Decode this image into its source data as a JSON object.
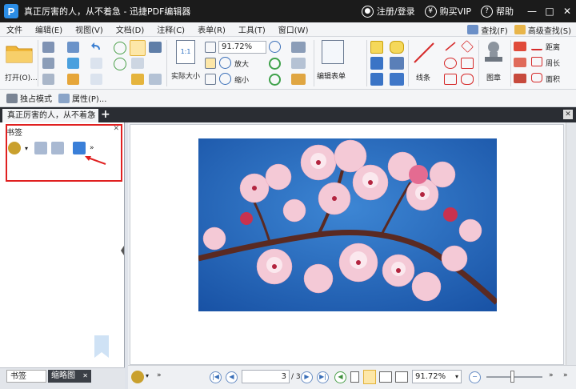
{
  "app": {
    "title": "真正厉害的人，从不着急 - 迅捷PDF编辑器",
    "logo_letter": "P",
    "register_login": "注册/登录",
    "buy_vip": "购买VIP",
    "help": "帮助"
  },
  "menu": {
    "items": [
      "文件",
      "编辑(E)",
      "视图(V)",
      "文档(D)",
      "注释(C)",
      "表单(R)",
      "工具(T)",
      "窗口(W)"
    ],
    "find": "查找(F)",
    "advanced_find": "高级查找(S)"
  },
  "ribbon": {
    "open_label": "打开(O)...",
    "zoom_value": "91.72%",
    "actual_size": "实际大小",
    "zoom_in": "放大",
    "zoom_out": "缩小",
    "edit_form": "编辑表单",
    "line": "线条",
    "stamp": "图章",
    "distance": "距离",
    "perimeter": "周长",
    "area": "面积"
  },
  "modebar": {
    "exclusive_mode": "独占模式",
    "properties": "属性(P)..."
  },
  "tabs": {
    "document_tab": "真正厉害的人，从不着急",
    "add": "+"
  },
  "left_panel": {
    "title": "书签",
    "tab_bookmarks": "书签",
    "tab_thumbnails": "缩略图"
  },
  "statusbar": {
    "current_page": "3",
    "total_pages": "/ 3",
    "zoom_value": "91.72%"
  },
  "colors": {
    "titlebar": "#1b1b1b",
    "highlight": "#e02020",
    "accent": "#2b8de6"
  }
}
